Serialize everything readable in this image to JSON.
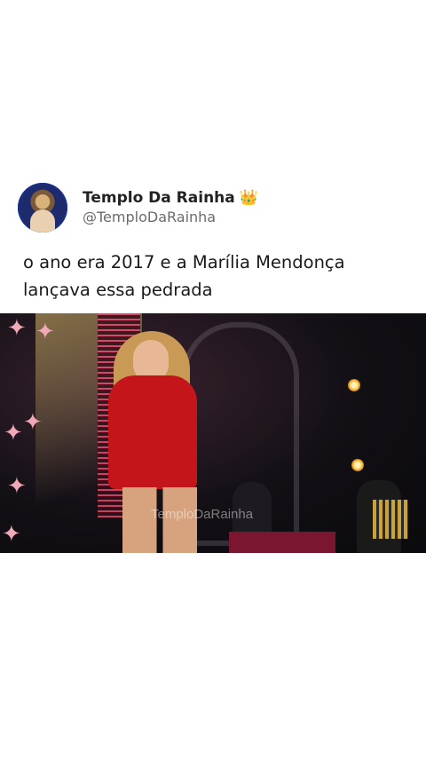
{
  "post": {
    "display_name": "Templo Da Rainha",
    "badge_icon": "crown-icon",
    "handle": "@TemploDaRainha",
    "text": "o ano era 2017 e a Marília Mendonça lançava essa pedrada"
  },
  "media": {
    "watermark": "TemploDaRainha",
    "accent_colors": {
      "dress": "#c4151a",
      "led": "#e24a6e"
    }
  }
}
